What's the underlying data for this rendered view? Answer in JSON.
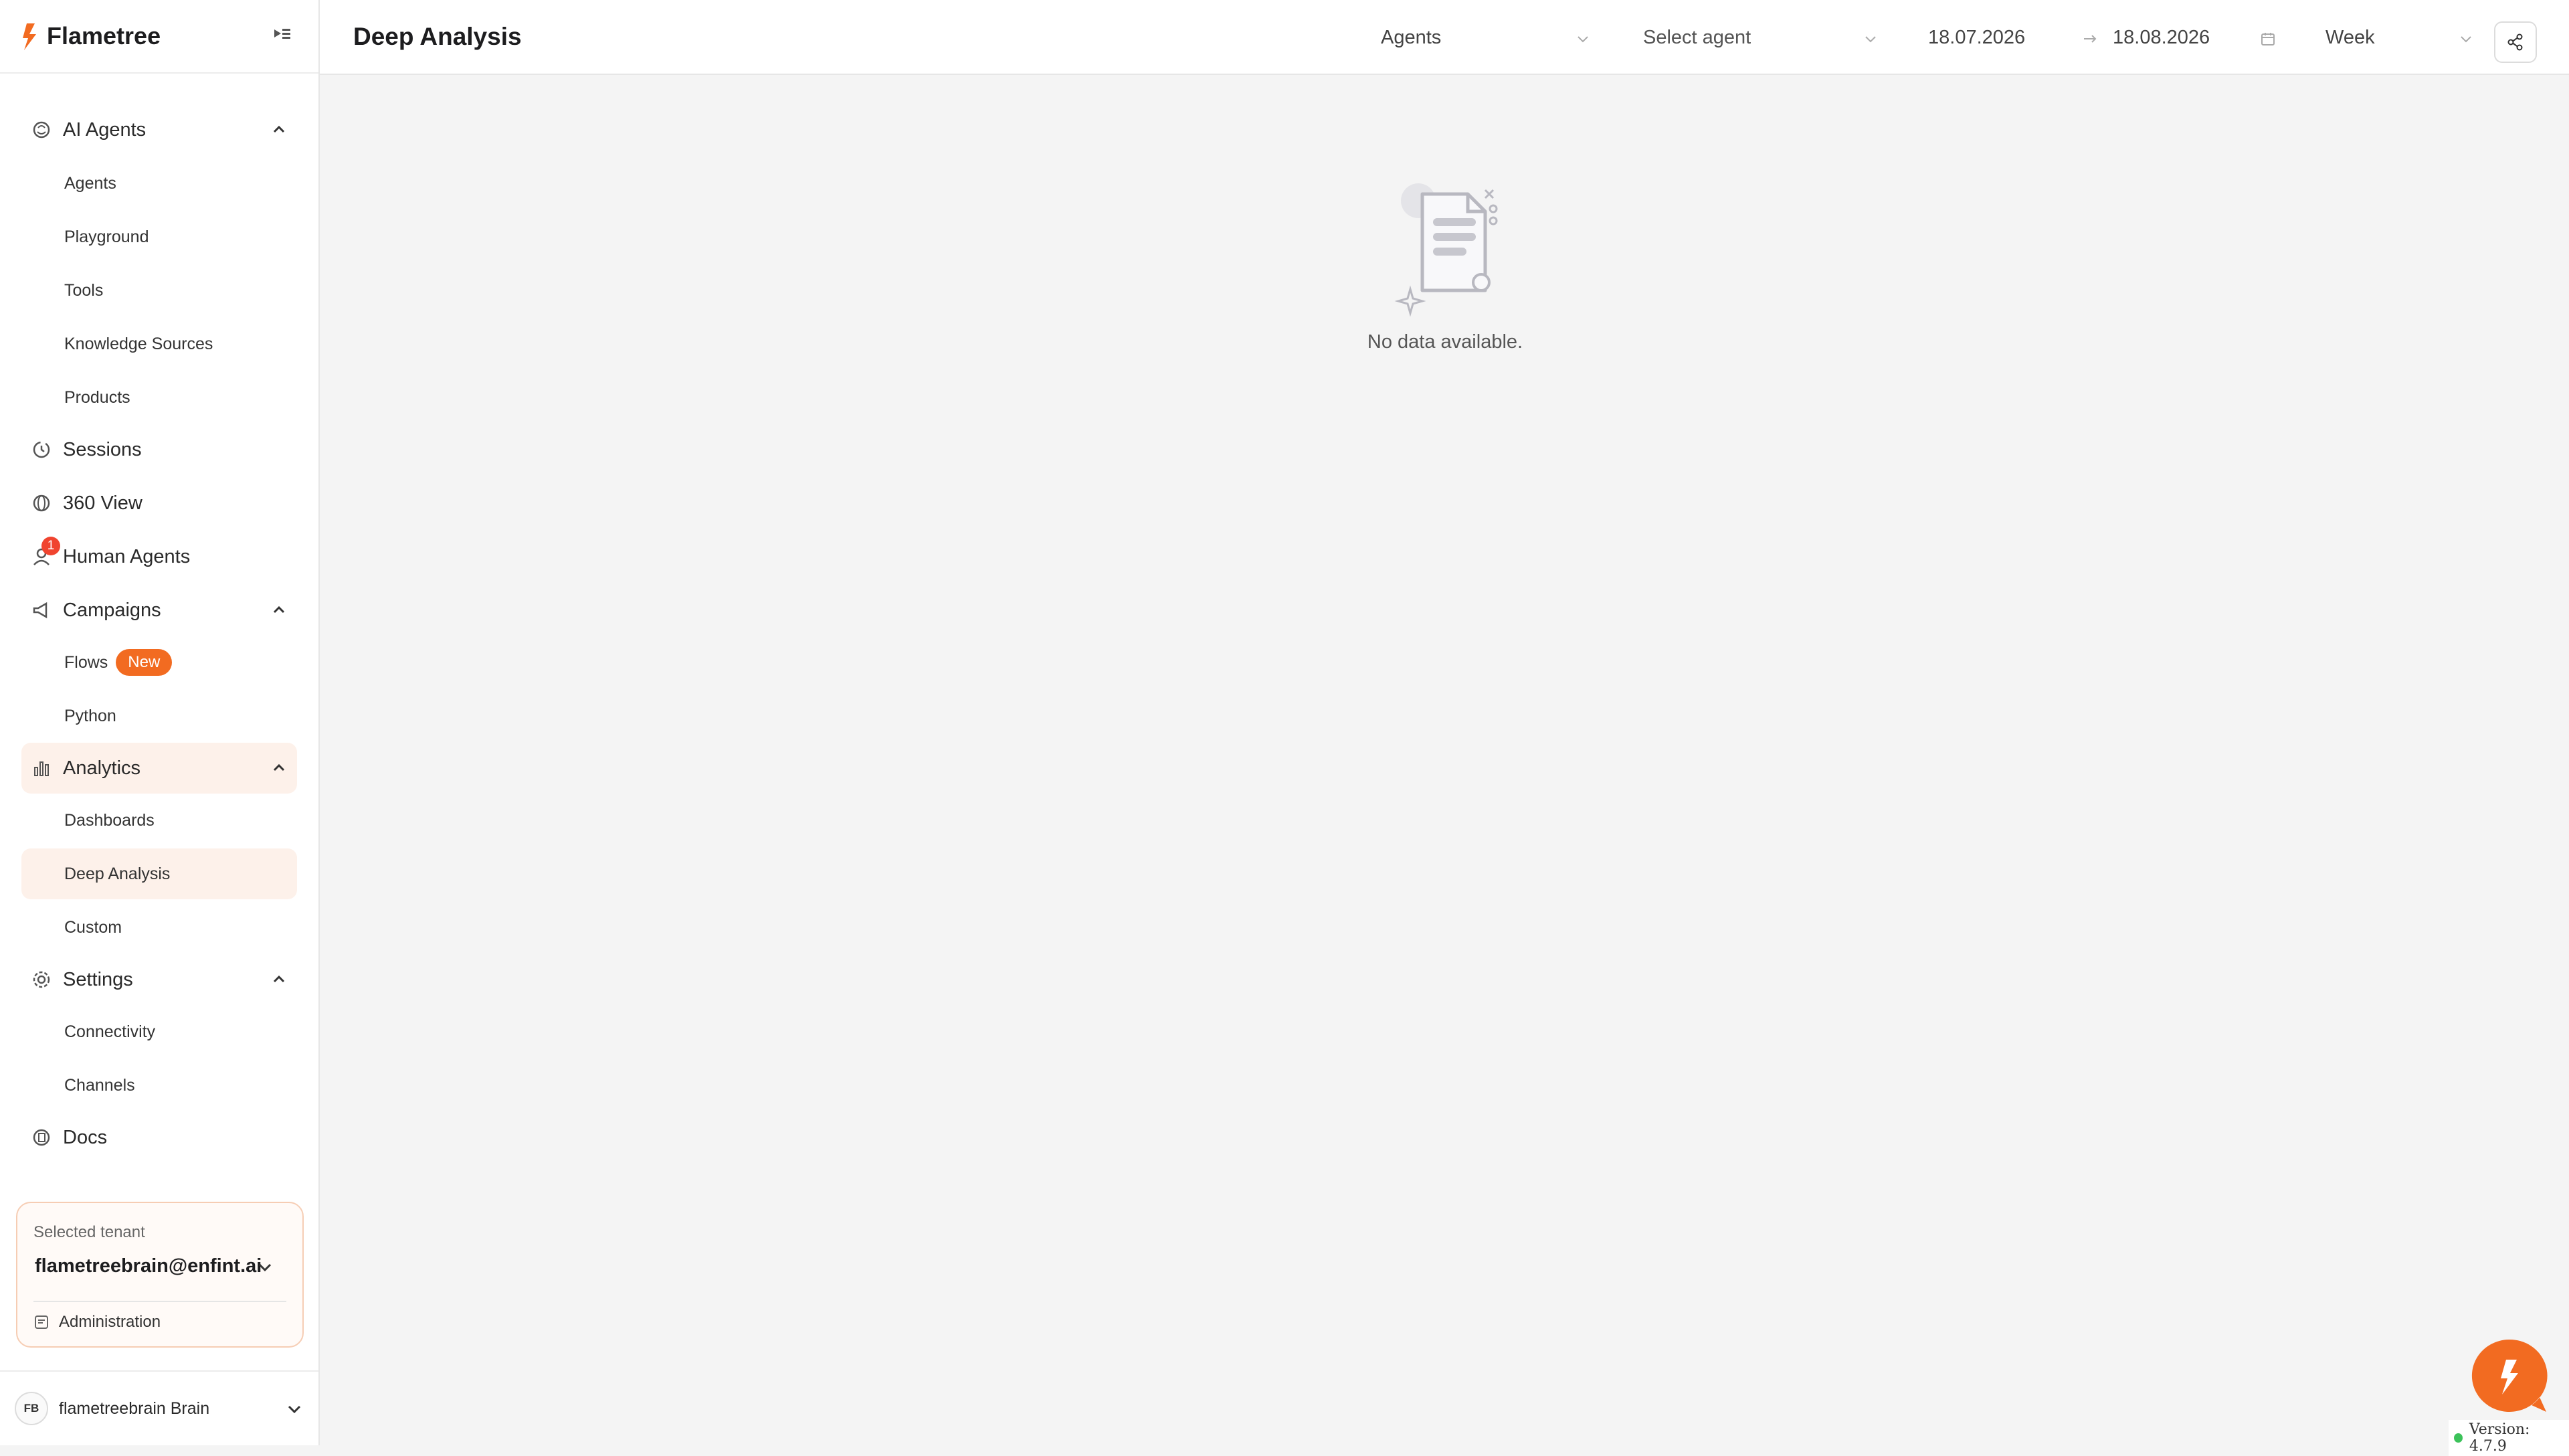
{
  "app": {
    "brand_name": "Flametree",
    "accent_color": "#f26b21"
  },
  "sidebar": {
    "groups": [
      {
        "label": "AI Agents",
        "icon": "brain-icon",
        "expanded": true,
        "items": [
          "Agents",
          "Playground",
          "Tools",
          "Knowledge Sources",
          "Products"
        ]
      },
      {
        "label": "Sessions",
        "icon": "history-icon"
      },
      {
        "label": "360 View",
        "icon": "globe-icon"
      },
      {
        "label": "Human Agents",
        "icon": "user-icon",
        "notification_count": "1"
      },
      {
        "label": "Campaigns",
        "icon": "megaphone-icon",
        "expanded": true,
        "items": [
          "Flows",
          "Python"
        ],
        "flows_badge": "New"
      },
      {
        "label": "Analytics",
        "icon": "bar-chart-icon",
        "expanded": true,
        "active": true,
        "items": [
          "Dashboards",
          "Deep Analysis",
          "Custom"
        ],
        "active_item": "Deep Analysis"
      },
      {
        "label": "Settings",
        "icon": "gear-icon",
        "expanded": true,
        "items": [
          "Connectivity",
          "Channels"
        ]
      },
      {
        "label": "Docs",
        "icon": "docs-icon"
      }
    ]
  },
  "tenant": {
    "label": "Selected tenant",
    "value": "flametreebrain@enfint.ai",
    "admin_label": "Administration"
  },
  "user": {
    "initials": "FB",
    "name": "flametreebrain Brain"
  },
  "header": {
    "title": "Deep Analysis",
    "type_filter": "Agents",
    "agent_filter_placeholder": "Select agent",
    "date_from": "18.07.2026",
    "date_to": "18.08.2026",
    "granularity": "Week"
  },
  "empty_state": {
    "text": "No data available."
  },
  "footer": {
    "version": "Version: 4.7.9"
  }
}
